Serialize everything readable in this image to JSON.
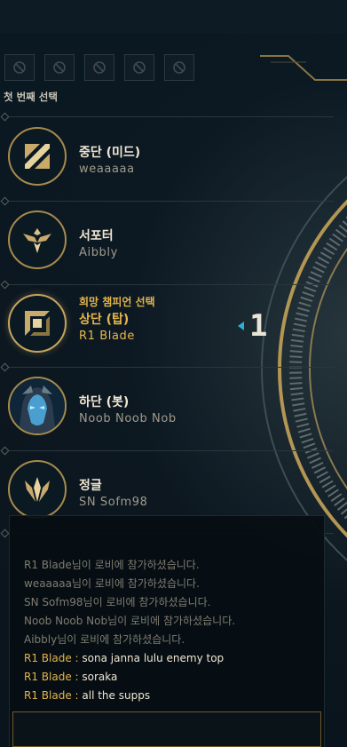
{
  "section_label": "첫 번째 선택",
  "ban_slots": [
    "ban-icon",
    "ban-icon",
    "ban-icon",
    "ban-icon",
    "ban-icon"
  ],
  "players": [
    {
      "role": "중단 (미드)",
      "name": "weaaaaa",
      "status": "",
      "icon": "mid-lane-icon",
      "active": false
    },
    {
      "role": "서포터",
      "name": "Aibbly",
      "status": "",
      "icon": "support-icon",
      "active": false
    },
    {
      "role": "상단 (탑)",
      "name": "R1 Blade",
      "status": "희망 챔피언 선택",
      "icon": "top-lane-icon",
      "active": true
    },
    {
      "role": "하단 (봇)",
      "name": "Noob Noob Nob",
      "status": "",
      "icon": "champion-portrait",
      "active": false
    },
    {
      "role": "정글",
      "name": "SN Sofm98",
      "status": "",
      "icon": "jungle-icon",
      "active": false
    }
  ],
  "pick_order": "1",
  "chat": {
    "messages": [
      {
        "type": "system",
        "text": "R1 Blade님이 로비에 참가하셨습니다."
      },
      {
        "type": "system",
        "text": "weaaaaa님이 로비에 참가하셨습니다."
      },
      {
        "type": "system",
        "text": "SN Sofm98님이 로비에 참가하셨습니다."
      },
      {
        "type": "system",
        "text": "Noob Noob Nob님이 로비에 참가하셨습니다."
      },
      {
        "type": "system",
        "text": "Aibbly님이 로비에 참가하셨습니다."
      },
      {
        "type": "user",
        "sender": "R1 Blade",
        "sep": " : ",
        "text": "sona janna lulu enemy top"
      },
      {
        "type": "user",
        "sender": "R1 Blade",
        "sep": " : ",
        "text": "soraka"
      },
      {
        "type": "user",
        "sender": "R1 Blade",
        "sep": " : ",
        "text": "all the supps"
      }
    ],
    "input_value": ""
  },
  "colors": {
    "gold": "#c6a35b",
    "accent_blue": "#2ab0df",
    "text_light": "#f0e6d2",
    "text_muted": "#a09b8c"
  }
}
